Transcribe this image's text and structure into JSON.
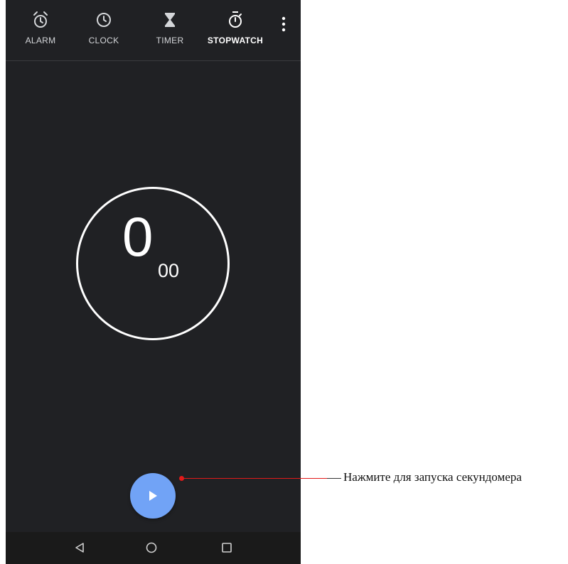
{
  "tabs": [
    {
      "label": "ALARM",
      "icon": "alarm-icon"
    },
    {
      "label": "CLOCK",
      "icon": "clock-icon"
    },
    {
      "label": "TIMER",
      "icon": "hourglass-icon"
    },
    {
      "label": "STOPWATCH",
      "icon": "stopwatch-icon",
      "active": true
    }
  ],
  "menu_icon": "more-vert-icon",
  "stopwatch": {
    "seconds": "0",
    "centiseconds": "00"
  },
  "start_button": {
    "icon": "play-icon",
    "color": "#71a3f6"
  },
  "nav": {
    "back_icon": "back-triangle-icon",
    "home_icon": "home-circle-icon",
    "recents_icon": "recents-square-icon"
  },
  "annotation": {
    "text": "Нажмите для запуска секундомера",
    "color": "#e11a1a"
  },
  "colors": {
    "app_background": "#202124",
    "nav_background": "#1a1a1a"
  }
}
